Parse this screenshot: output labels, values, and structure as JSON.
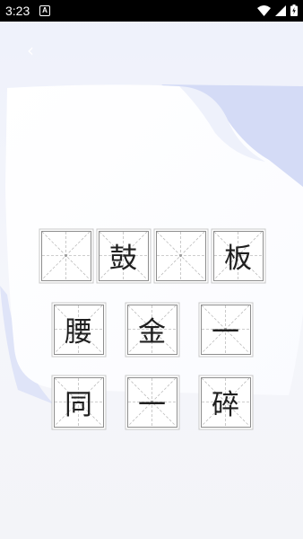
{
  "status_bar": {
    "time": "3:23",
    "notification_icon": "A",
    "icons": [
      "wifi-icon",
      "signal-icon",
      "battery-charging-icon"
    ]
  },
  "nav": {
    "back_icon": "chevron-left-icon",
    "back_glyph": "‹"
  },
  "puzzle": {
    "rows": [
      [
        "",
        "鼓",
        "",
        "板"
      ],
      [
        "腰",
        "金",
        "一"
      ],
      [
        "同",
        "一",
        "碎"
      ]
    ]
  },
  "colors": {
    "cell_border": "#8d8d8d",
    "guide_lines": "#bdbdbd",
    "paper": "#ffffff",
    "paper_shadow": "#cdd5f4"
  }
}
